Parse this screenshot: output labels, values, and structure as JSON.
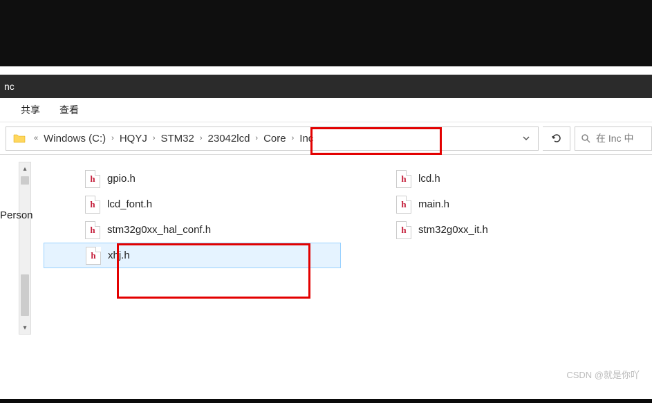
{
  "titlebar": {
    "title": "nc"
  },
  "menu": {
    "share": "共享",
    "view": "查看"
  },
  "breadcrumb": {
    "overflow": "«",
    "items": [
      "Windows (C:)",
      "HQYJ",
      "STM32",
      "23042lcd",
      "Core",
      "Inc"
    ]
  },
  "search": {
    "placeholder": "在 Inc 中"
  },
  "sidebar": {
    "label": "Person"
  },
  "files": {
    "col1": [
      {
        "name": "gpio.h"
      },
      {
        "name": "lcd_font.h"
      },
      {
        "name": "stm32g0xx_hal_conf.h"
      },
      {
        "name": "xhj.h",
        "selected": true
      }
    ],
    "col2": [
      {
        "name": "lcd.h"
      },
      {
        "name": "main.h"
      },
      {
        "name": "stm32g0xx_it.h"
      }
    ]
  },
  "watermark": "CSDN @就是你吖"
}
